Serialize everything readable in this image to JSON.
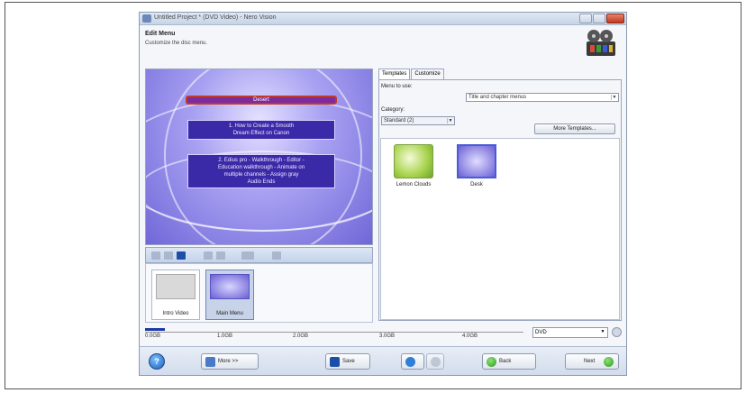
{
  "window": {
    "title": "Untitled Project * (DVD Video) - Nero Vision",
    "controls": [
      "minimize",
      "maximize",
      "close"
    ]
  },
  "header": {
    "title": "Edit Menu",
    "subtitle": "Customize the disc menu."
  },
  "preview": {
    "menu_title": "Desert",
    "items": [
      [
        "1. How to Create a Smooth",
        "Dream Effect on Canon"
      ],
      [
        "2. Edius pro - Walkthrough - Editor -",
        "Education walkthrough - Animate on",
        "multiple channels - Assign gray",
        "Audio Ends"
      ]
    ]
  },
  "preview_toolbar": {
    "icons": [
      "undo-icon",
      "redo-icon",
      "save-icon",
      "grid-icon",
      "layout-icon",
      "frame-dropdown-icon",
      "audio-icon"
    ]
  },
  "thumbnails": [
    {
      "label": "Intro Video",
      "selected": false
    },
    {
      "label": "Main Menu",
      "selected": true
    }
  ],
  "tabs": [
    {
      "label": "Templates",
      "active": true
    },
    {
      "label": "Customize",
      "active": false
    }
  ],
  "templates_panel": {
    "menu_to_use_label": "Menu to use:",
    "menu_to_use_value": "Title and chapter menus",
    "category_label": "Category:",
    "category_value": "Standard (2)",
    "more_templates_label": "More Templates...",
    "items": [
      {
        "label": "Lemon Clouds"
      },
      {
        "label": "Desk"
      }
    ]
  },
  "timeline": {
    "start_label": "0.0GB",
    "ticks": [
      "1.0GB",
      "2.0GB",
      "3.0GB",
      "4.0GB"
    ],
    "disc_type": "DVD"
  },
  "bottom_bar": {
    "more_label": "More >>",
    "save_label": "Save",
    "back_label": "Back",
    "next_label": "Next"
  }
}
